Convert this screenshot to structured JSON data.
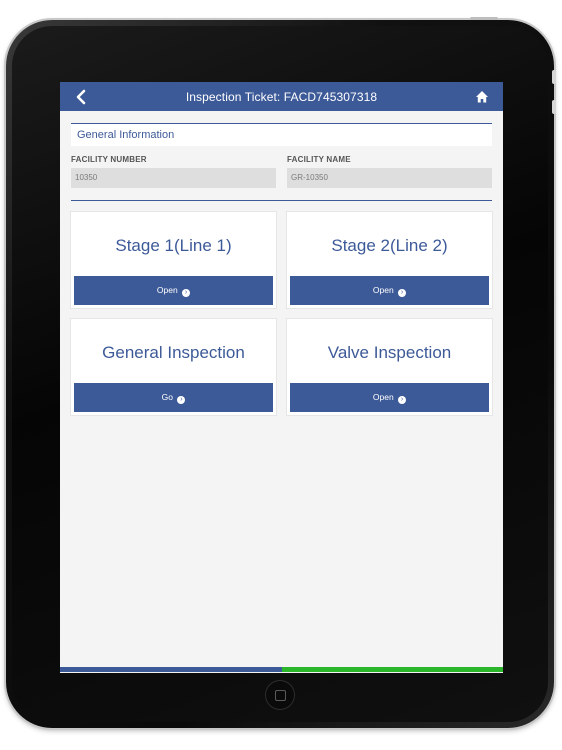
{
  "header": {
    "title": "Inspection Ticket: FACD745307318"
  },
  "section": {
    "title": "General Information"
  },
  "fields": [
    {
      "label": "FACILITY NUMBER",
      "value": "10350"
    },
    {
      "label": "FACILITY NAME",
      "value": "GR-10350"
    }
  ],
  "cards": [
    {
      "title": "Stage 1(Line 1)",
      "button": "Open"
    },
    {
      "title": "Stage 2(Line 2)",
      "button": "Open"
    },
    {
      "title": "General Inspection",
      "button": "Go"
    },
    {
      "title": "Valve Inspection",
      "button": "Open"
    }
  ],
  "progress": {
    "completed_fraction": 0.5
  },
  "colors": {
    "primary": "#3d5a98",
    "success": "#2bb52b",
    "background": "#f4f4f4"
  }
}
